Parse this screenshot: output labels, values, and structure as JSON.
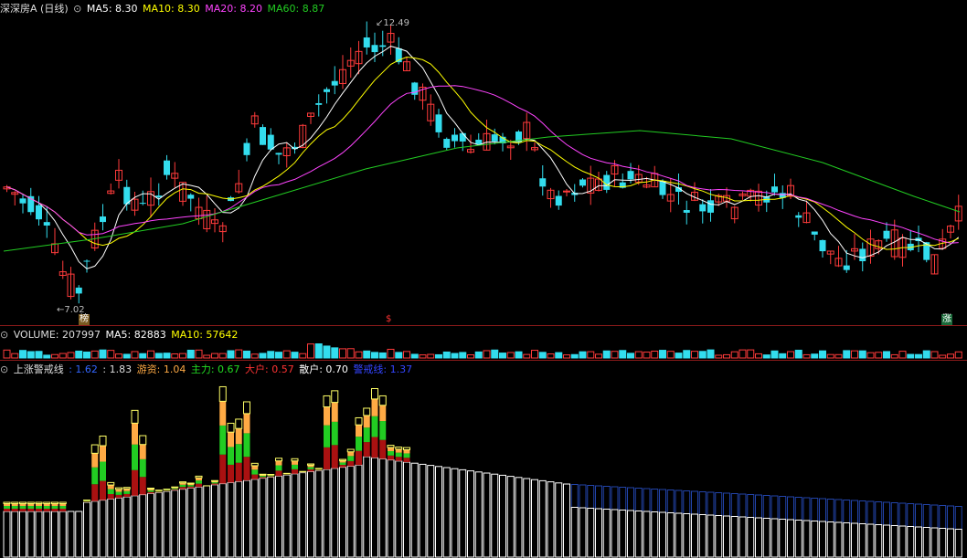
{
  "main_panel": {
    "title": "深深房A (日线)",
    "indicators": [
      {
        "label": "MA5: 8.30",
        "color": "#ffffff"
      },
      {
        "label": "MA10: 8.30",
        "color": "#ffff00"
      },
      {
        "label": "MA20: 8.20",
        "color": "#ff44ff"
      },
      {
        "label": "MA60: 8.87",
        "color": "#22cc22"
      }
    ],
    "high_label": "12.49",
    "low_label": "7.02",
    "tags": {
      "left": "榜",
      "mid": "$",
      "right": "涨"
    }
  },
  "volume_panel": {
    "title": "VOLUME: 207997",
    "ma5": "MA5: 82883",
    "ma10": "MA10: 57642"
  },
  "indicator_panel": {
    "title": "上涨警戒线",
    "values": [
      {
        "label": ": 1.62",
        "color": "#3366ff"
      },
      {
        "label": ": 1.83",
        "color": "#dddddd"
      },
      {
        "label": "游资: 1.04",
        "color": "#ffaa44"
      },
      {
        "label": "主力: 0.67",
        "color": "#22dd22"
      },
      {
        "label": "大户: 0.57",
        "color": "#ff3333"
      },
      {
        "label": "散户: 0.70",
        "color": "#ffffff"
      },
      {
        "label": "警戒线: 1.37",
        "color": "#3344ff"
      }
    ]
  },
  "colors": {
    "up": "#ff3b3b",
    "down": "#33ddee",
    "ma5": "#ffffff",
    "ma10": "#ffff00",
    "ma20": "#ff44ff",
    "ma60": "#22cc22",
    "separator": "#8b1a1a"
  },
  "chart_data": {
    "type": "candlestick",
    "price_range_visible": [
      7.02,
      12.49
    ],
    "ma_latest": {
      "MA5": 8.3,
      "MA10": 8.3,
      "MA20": 8.2,
      "MA60": 8.87
    },
    "volume_latest": 207997,
    "volume_ma": {
      "MA5": 82883,
      "MA10": 57642
    }
  }
}
